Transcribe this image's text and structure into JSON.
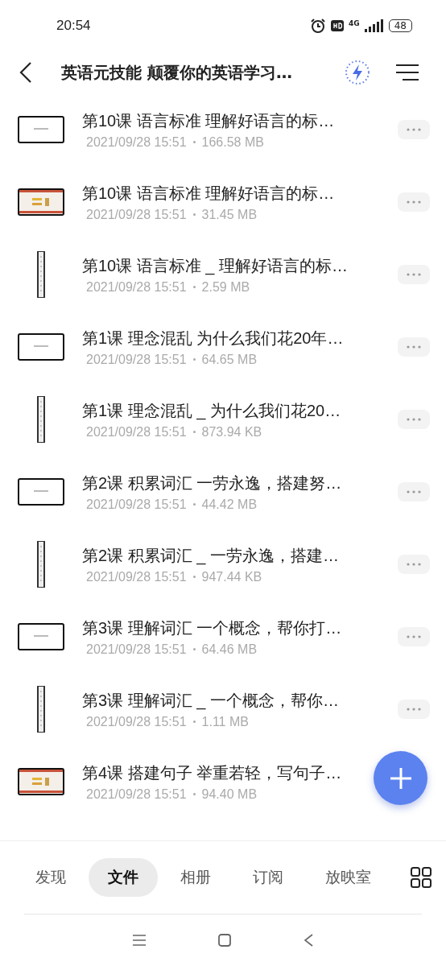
{
  "status_bar": {
    "time": "20:54",
    "network": "4G",
    "battery": "48"
  },
  "header": {
    "title": "英语元技能  颠覆你的英语学习…"
  },
  "files": [
    {
      "title": "第10课 语言标准  理解好语言的标…",
      "date": "2021/09/28 15:51",
      "size": "166.58 MB",
      "kind": "slide",
      "more_button": true
    },
    {
      "title": "第10课 语言标准  理解好语言的标…",
      "date": "2021/09/28 15:51",
      "size": "31.45 MB",
      "kind": "slide-color",
      "more_button": true
    },
    {
      "title": "第10课 语言标准 _ 理解好语言的标…",
      "date": "2021/09/28 15:51",
      "size": "2.59 MB",
      "kind": "strip",
      "more_button": true
    },
    {
      "title": "第1课 理念混乱  为什么我们花20年…",
      "date": "2021/09/28 15:51",
      "size": "64.65 MB",
      "kind": "slide",
      "more_button": true
    },
    {
      "title": "第1课 理念混乱 _ 为什么我们花20…",
      "date": "2021/09/28 15:51",
      "size": "873.94 KB",
      "kind": "strip",
      "more_button": true
    },
    {
      "title": "第2课 积累词汇  一劳永逸，搭建努…",
      "date": "2021/09/28 15:51",
      "size": "44.42 MB",
      "kind": "slide",
      "more_button": true
    },
    {
      "title": "第2课 积累词汇 _ 一劳永逸，搭建…",
      "date": "2021/09/28 15:51",
      "size": "947.44 KB",
      "kind": "strip",
      "more_button": true
    },
    {
      "title": "第3课 理解词汇  一个概念，帮你打…",
      "date": "2021/09/28 15:51",
      "size": "64.46 MB",
      "kind": "slide",
      "more_button": true
    },
    {
      "title": "第3课 理解词汇 _ 一个概念，帮你…",
      "date": "2021/09/28 15:51",
      "size": "1.11 MB",
      "kind": "strip",
      "more_button": true
    },
    {
      "title": "第4课 搭建句子  举重若轻，写句子…",
      "date": "2021/09/28 15:51",
      "size": "94.40 MB",
      "kind": "slide-color",
      "more_button": false
    }
  ],
  "tabs": [
    {
      "label": "发现",
      "selected": false
    },
    {
      "label": "文件",
      "selected": true
    },
    {
      "label": "相册",
      "selected": false
    },
    {
      "label": "订阅",
      "selected": false
    },
    {
      "label": "放映室",
      "selected": false
    }
  ]
}
